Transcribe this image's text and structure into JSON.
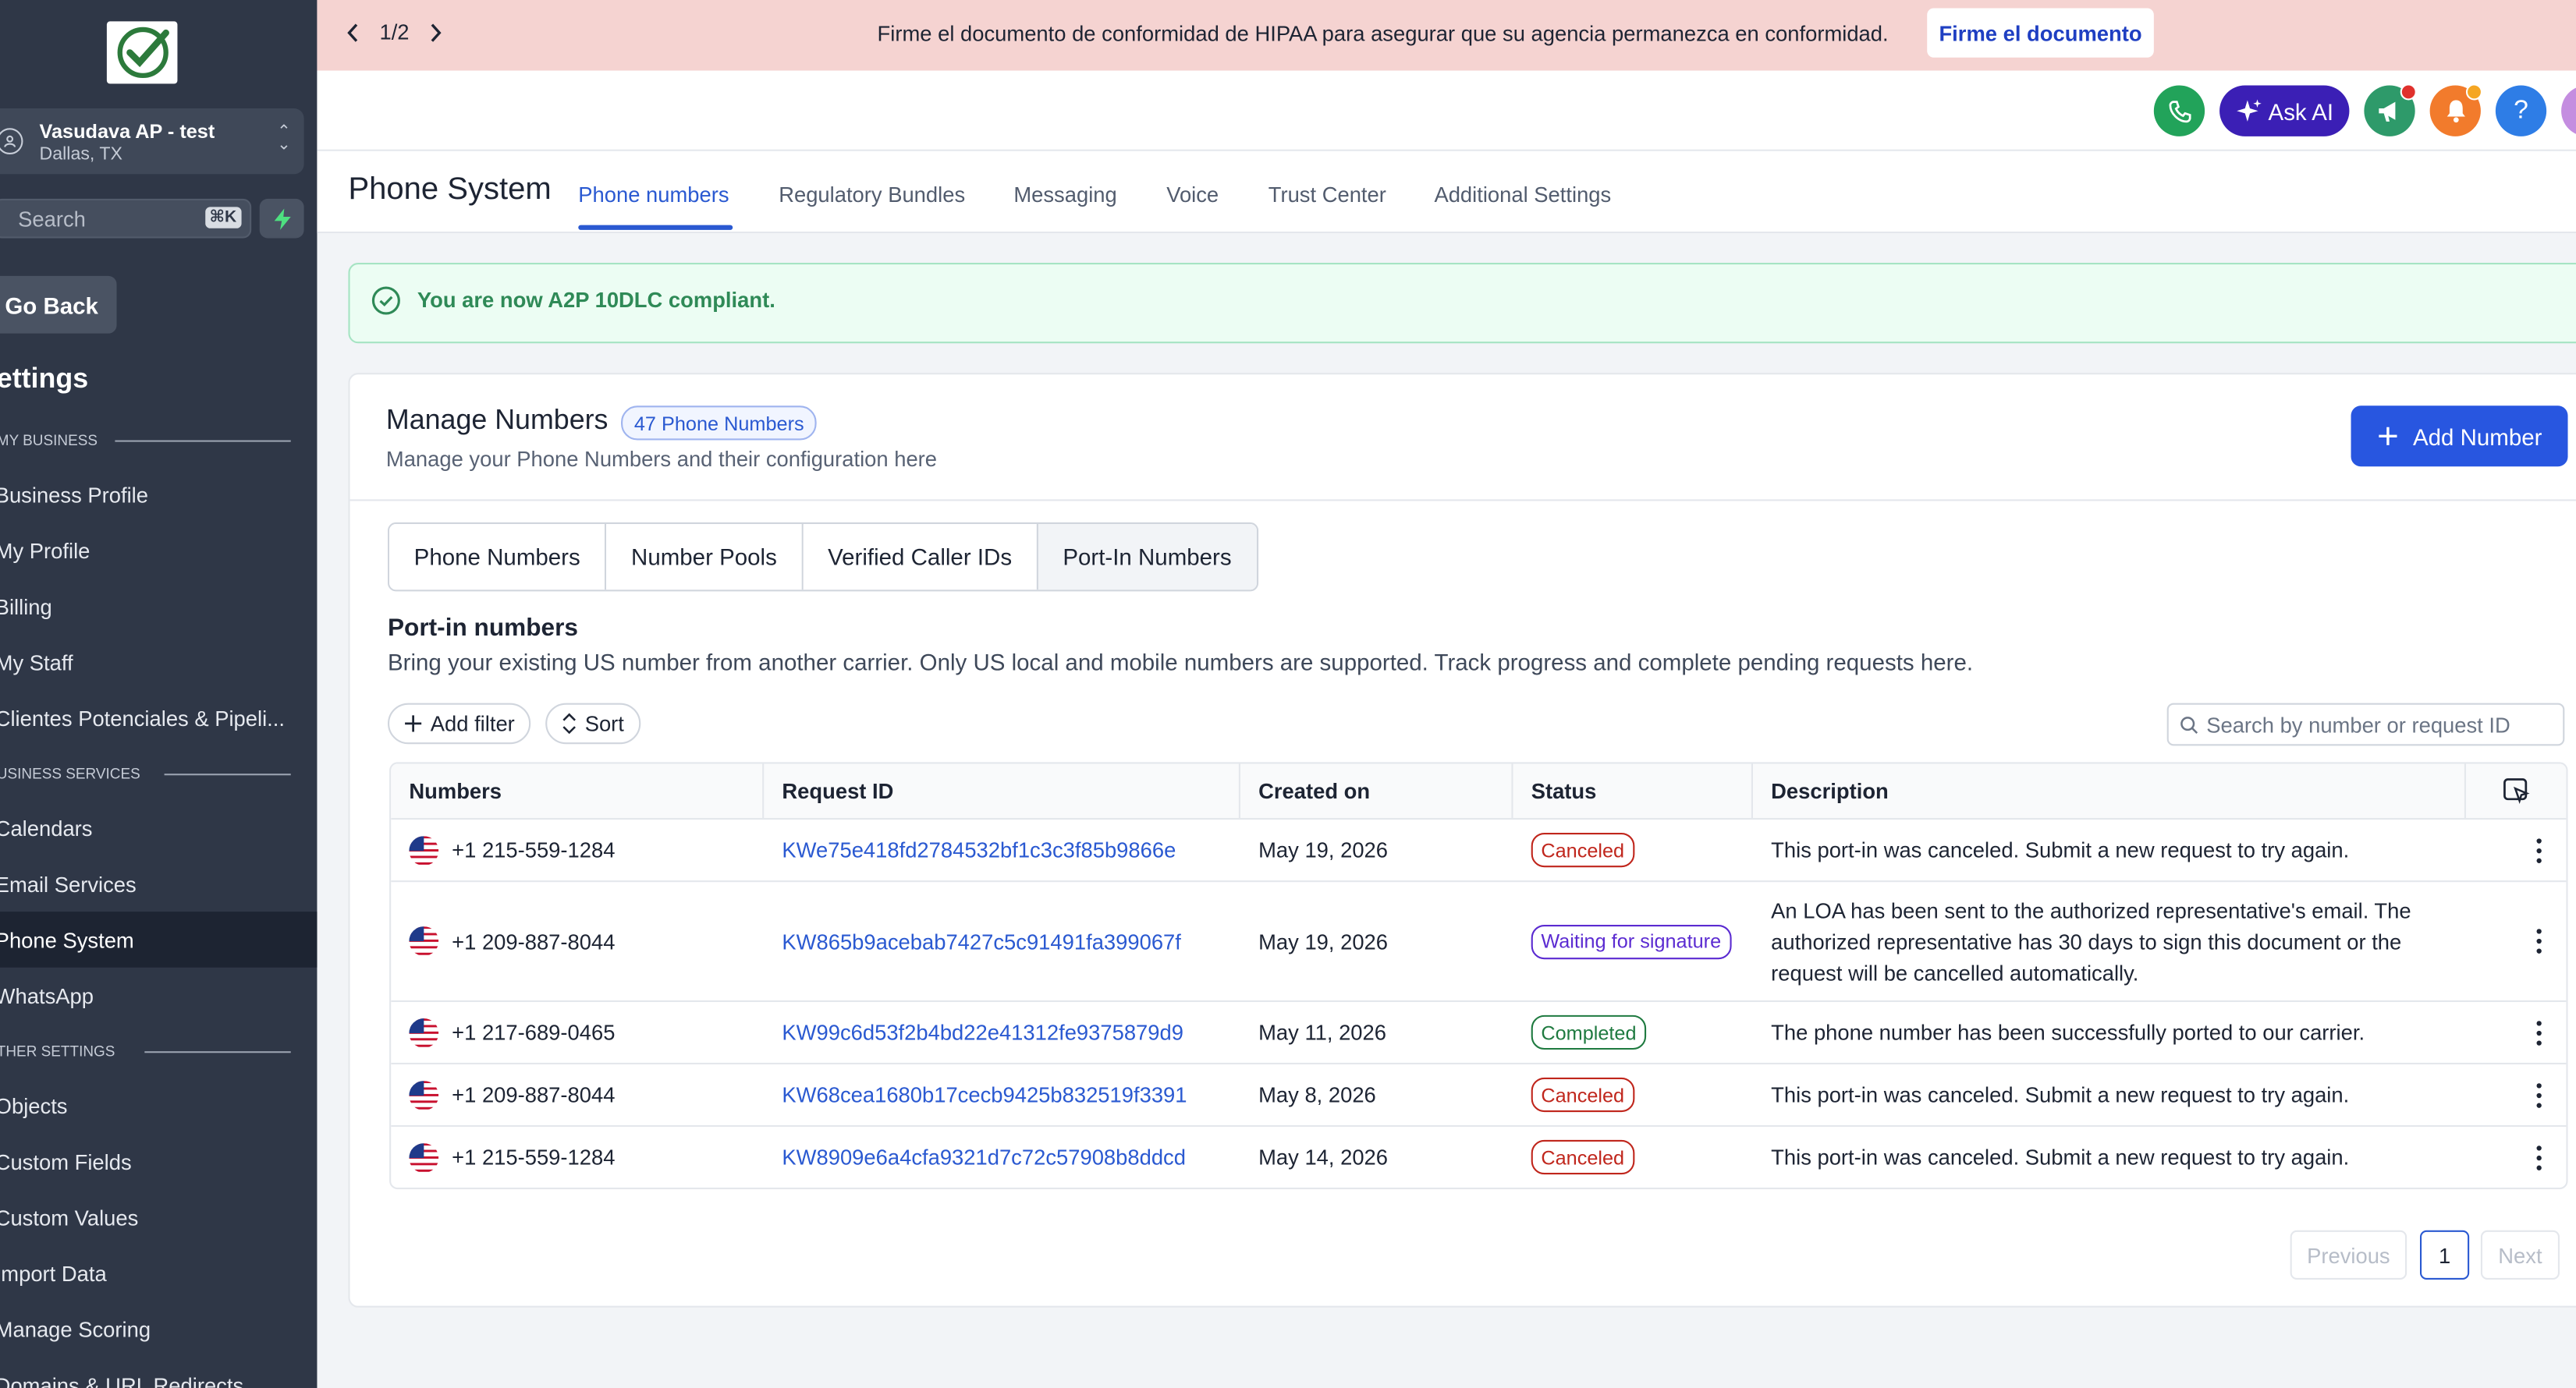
{
  "sidebar": {
    "account": {
      "name": "Vasudava AP - test",
      "location": "Dallas, TX"
    },
    "search": {
      "placeholder": "Search",
      "shortcut": "⌘K"
    },
    "go_back": "Go Back",
    "settings_title": "ettings",
    "sections": [
      {
        "label": "MY BUSINESS"
      },
      {
        "label": "USINESS SERVICES"
      },
      {
        "label": "THER SETTINGS"
      }
    ],
    "items": [
      {
        "label": "Business Profile"
      },
      {
        "label": "My Profile"
      },
      {
        "label": "Billing"
      },
      {
        "label": "My Staff"
      },
      {
        "label": "Clientes Potenciales & Pipeli..."
      },
      {
        "label": "Calendars"
      },
      {
        "label": "Email Services"
      },
      {
        "label": "Phone System",
        "active": true
      },
      {
        "label": "WhatsApp"
      },
      {
        "label": "Objects"
      },
      {
        "label": "Custom Fields"
      },
      {
        "label": "Custom Values"
      },
      {
        "label": "Import Data"
      },
      {
        "label": "Manage Scoring"
      },
      {
        "label": "Domains & URL Redirects"
      }
    ]
  },
  "banner": {
    "pager": "1/2",
    "message": "Firme el documento de conformidad de HIPAA para asegurar que su agencia permanezca en conformidad.",
    "button": "Firme el documento"
  },
  "topbar": {
    "ask_ai": "Ask AI",
    "help": "?"
  },
  "page": {
    "title": "Phone System",
    "tabs": [
      {
        "label": "Phone numbers",
        "active": true
      },
      {
        "label": "Regulatory Bundles"
      },
      {
        "label": "Messaging"
      },
      {
        "label": "Voice"
      },
      {
        "label": "Trust Center"
      },
      {
        "label": "Additional Settings"
      }
    ]
  },
  "success": {
    "message": "You are now A2P 10DLC compliant."
  },
  "manage": {
    "title": "Manage Numbers",
    "count_badge": "47 Phone Numbers",
    "subtitle": "Manage your Phone Numbers and their configuration here",
    "add_button": "Add Number",
    "segments": [
      "Phone Numbers",
      "Number Pools",
      "Verified Caller IDs",
      "Port-In Numbers"
    ],
    "active_segment": "Port-In Numbers"
  },
  "portin": {
    "title": "Port-in numbers",
    "description": "Bring your existing US number from another carrier. Only US local and mobile numbers are supported. Track progress and complete pending requests here.",
    "add_filter": "Add filter",
    "sort": "Sort",
    "search_placeholder": "Search by number or request ID",
    "columns": [
      "Numbers",
      "Request ID",
      "Created on",
      "Status",
      "Description"
    ],
    "rows": [
      {
        "number": "+1 215-559-1284",
        "request_id": "KWe75e418fd2784532bf1c3c3f85b9866e",
        "created": "May 19, 2026",
        "status": "Canceled",
        "description": "This port-in was canceled. Submit a new request to try again."
      },
      {
        "number": "+1 209-887-8044",
        "request_id": "KW865b9acebab7427c5c91491fa399067f",
        "created": "May 19, 2026",
        "status": "Waiting for signature",
        "description": "An LOA has been sent to the authorized representative's email. The authorized representative has 30 days to sign this document or the request will be cancelled automatically."
      },
      {
        "number": "+1 217-689-0465",
        "request_id": "KW99c6d53f2b4bd22e41312fe9375879d9",
        "created": "May 11, 2026",
        "status": "Completed",
        "description": "The phone number has been successfully ported to our carrier."
      },
      {
        "number": "+1 209-887-8044",
        "request_id": "KW68cea1680b17cecb9425b832519f3391",
        "created": "May 8, 2026",
        "status": "Canceled",
        "description": "This port-in was canceled. Submit a new request to try again."
      },
      {
        "number": "+1 215-559-1284",
        "request_id": "KW8909e6a4cfa9321d7c72c57908b8ddcd",
        "created": "May 14, 2026",
        "status": "Canceled",
        "description": "This port-in was canceled. Submit a new request to try again."
      }
    ]
  },
  "pagination": {
    "previous": "Previous",
    "current": "1",
    "next": "Next"
  },
  "colors": {
    "primary": "#2856e0",
    "sidebar": "#2f3747",
    "banner": "#f5d3d1",
    "success": "#2f8a57"
  }
}
